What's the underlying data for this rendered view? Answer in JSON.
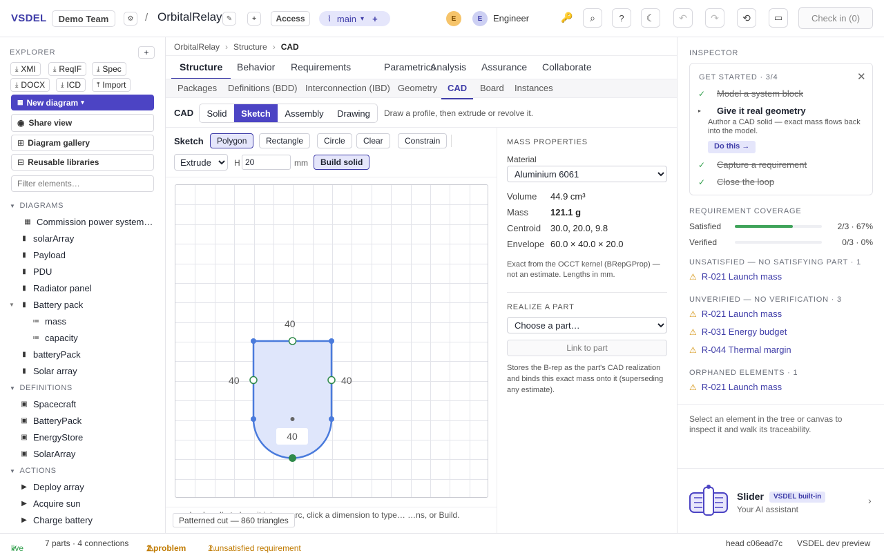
{
  "topbar": {
    "brand": "VSDEL",
    "team": "Demo Team",
    "separator": "/",
    "project": "OrbitalRelay",
    "access": "Access",
    "branch": "main",
    "avatar1": "E",
    "avatar2": "E",
    "role": "Engineer",
    "check_in": "Check in (0)"
  },
  "explorer": {
    "title": "EXPLORER",
    "export_buttons": [
      "XMI",
      "ReqIF",
      "Spec",
      "DOCX",
      "ICD",
      "Import"
    ],
    "new_diagram": "New diagram",
    "share_view": "Share view",
    "diagram_gallery": "Diagram gallery",
    "reusable_libraries": "Reusable libraries",
    "filter_placeholder": "Filter elements…",
    "sections": {
      "diagrams": "DIAGRAMS",
      "definitions": "DEFINITIONS",
      "actions": "ACTIONS"
    },
    "diagrams": [
      "Commission power system…",
      "solarArray",
      "Payload",
      "PDU",
      "Radiator panel",
      "Battery pack",
      "mass",
      "capacity",
      "batteryPack",
      "Solar array"
    ],
    "definitions": [
      "Spacecraft",
      "BatteryPack",
      "EnergyStore",
      "SolarArray"
    ],
    "actions": [
      "Deploy array",
      "Acquire sun",
      "Charge battery"
    ]
  },
  "breadcrumb": [
    "OrbitalRelay",
    "Structure",
    "CAD"
  ],
  "tabs": [
    "Structure",
    "Behavior",
    "Requirements",
    "Parametrics",
    "Analysis",
    "Assurance",
    "Collaborate"
  ],
  "subtabs": [
    "Packages",
    "Definitions (BDD)",
    "Interconnection (IBD)",
    "Geometry",
    "CAD",
    "Board",
    "Instances"
  ],
  "cad": {
    "label": "CAD",
    "modes": [
      "Solid",
      "Sketch",
      "Assembly",
      "Drawing"
    ],
    "hint": "Draw a profile, then extrude or revolve it.",
    "sketch_label": "Sketch",
    "tools": [
      "Polygon",
      "Rectangle",
      "Circle",
      "Clear",
      "Constrain"
    ],
    "operation": "Extrude",
    "height_label": "H",
    "height_value": "20",
    "unit": "mm",
    "build": "Build solid",
    "dims": {
      "top": "40",
      "left": "40",
      "right": "40",
      "bottom": "40"
    },
    "footer_hint": "…edge handle to bow it into an arc, click a dimension to type… …ns, or Build.",
    "tooltip": "Patterned cut — 860 triangles"
  },
  "mass": {
    "title": "MASS PROPERTIES",
    "material_label": "Material",
    "material": "Aluminium 6061",
    "rows": [
      {
        "label": "Volume",
        "value": "44.9 cm³"
      },
      {
        "label": "Mass",
        "value": "121.1 g"
      },
      {
        "label": "Centroid",
        "value": "30.0, 20.0, 9.8"
      },
      {
        "label": "Envelope",
        "value": "60.0 × 40.0 × 20.0"
      }
    ],
    "note": "Exact from the OCCT kernel (BRepGProp) — not an estimate. Lengths in mm.",
    "realize_title": "REALIZE A PART",
    "choose_part": "Choose a part…",
    "link_button": "Link to part",
    "realize_note": "Stores the B-rep as the part's CAD realization and binds this exact mass onto it (superseding any estimate)."
  },
  "inspector": {
    "title": "INSPECTOR",
    "get_started": "GET STARTED · 3/4",
    "steps": [
      {
        "label": "Model a system block",
        "done": true
      },
      {
        "label": "Give it real geometry",
        "done": false
      },
      {
        "label": "Capture a requirement",
        "done": true
      },
      {
        "label": "Close the loop",
        "done": true
      }
    ],
    "step_desc": "Author a CAD solid — exact mass flows back into the model.",
    "do_this": "Do this →",
    "coverage_title": "REQUIREMENT COVERAGE",
    "satisfied_label": "Satisfied",
    "satisfied_value": "2/3 · 67%",
    "satisfied_fraction": 0.67,
    "verified_label": "Verified",
    "verified_value": "0/3 · 0%",
    "verified_fraction": 0,
    "unsatisfied_title": "UNSATISFIED — NO SATISFYING PART · 1",
    "unsatisfied": [
      "R-021 Launch mass"
    ],
    "unverified_title": "UNVERIFIED — NO VERIFICATION · 3",
    "unverified": [
      "R-021 Launch mass",
      "R-031 Energy budget",
      "R-044 Thermal margin"
    ],
    "orphaned_title": "ORPHANED ELEMENTS · 1",
    "orphaned": [
      "R-021 Launch mass"
    ],
    "select_hint": "Select an element in the tree or canvas to inspect it and walk its traceability.",
    "assistant_name": "Slider",
    "assistant_badge": "VSDEL built-in",
    "assistant_sub": "Your AI assistant"
  },
  "status": {
    "live": "live",
    "counts": "7 parts · 4 connections",
    "problem": "1 problem",
    "unsatisfied": "1 unsatisfied requirement",
    "head": "head c06ead7c",
    "env": "VSDEL dev preview"
  },
  "colors": {
    "accent": "#3f3da8",
    "success": "#2f9e4a",
    "warning": "#d4920c",
    "sketch_fill": "#dfe6fb",
    "sketch_stroke": "#4a7bdc"
  }
}
